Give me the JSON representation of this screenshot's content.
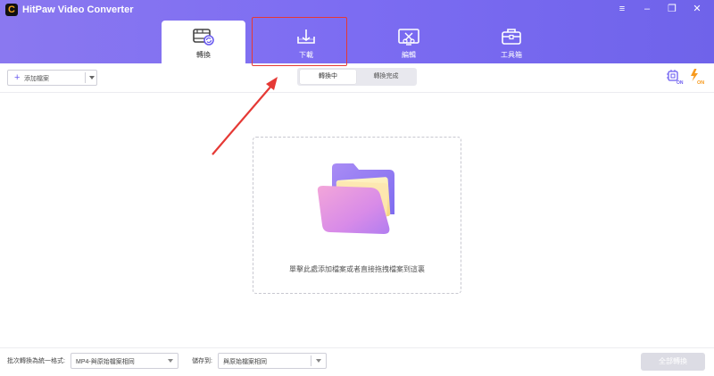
{
  "window": {
    "title": "HitPaw Video Converter",
    "logo_letter": "C",
    "controls": {
      "menu": "≡",
      "minimize": "–",
      "restore": "❐",
      "close": "✕"
    }
  },
  "tabs": [
    {
      "label": "轉換",
      "icon": "film-convert-icon",
      "active": true
    },
    {
      "label": "下載",
      "icon": "download-tray-icon",
      "active": false
    },
    {
      "label": "編輯",
      "icon": "edit-scissors-icon",
      "active": false
    },
    {
      "label": "工具箱",
      "icon": "toolbox-icon",
      "active": false
    }
  ],
  "toolbar": {
    "add_label": "添加檔案",
    "segments": {
      "active": "轉換中",
      "inactive": "轉換完成"
    },
    "hw_accel_badge": "ON",
    "boost_badge": "ON"
  },
  "drop_zone": {
    "text": "單擊此處添加檔案或者直接拖拽檔案到這裏"
  },
  "bottom": {
    "format_label": "批次轉換為統一格式:",
    "format_value": "MP4-與原始檔案相同",
    "save_label": "儲存到:",
    "save_value": "與原始檔案相同",
    "convert_all": "全部轉換"
  },
  "colors": {
    "header_start": "#8a78f0",
    "header_end": "#6f63ea",
    "accent": "#6b5cf0",
    "annotation_red": "#e53935",
    "boost_orange": "#f79a1e"
  }
}
